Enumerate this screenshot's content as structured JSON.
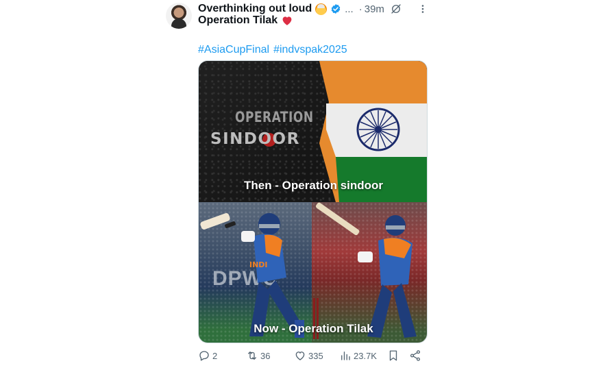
{
  "author": {
    "display_name": "Overthinking out loud",
    "emoji": "exploding-head-emoji",
    "verified": true,
    "more_label": "...",
    "separator": "·",
    "time": "39m"
  },
  "tweet": {
    "text": "Operation Tilak",
    "hashtags": [
      "#AsiaCupFinal",
      "#indvspak2025"
    ]
  },
  "media": {
    "top_panel": {
      "title_line1": "OPERATION",
      "title_line2": "SINDOOR",
      "caption": "Then - Operation sindoor"
    },
    "bottom_panel": {
      "caption": "Now - Operation Tilak",
      "board_text": "DPWC",
      "jersey_text": "INDI"
    }
  },
  "actions": {
    "replies": "2",
    "reposts": "36",
    "likes": "335",
    "views": "23.7K"
  },
  "colors": {
    "link": "#1d9bf0",
    "muted": "#536471",
    "verified": "#1d9bf0",
    "saffron": "#e68a2e",
    "green": "#157a2c",
    "chakra": "#1b2a6b"
  }
}
